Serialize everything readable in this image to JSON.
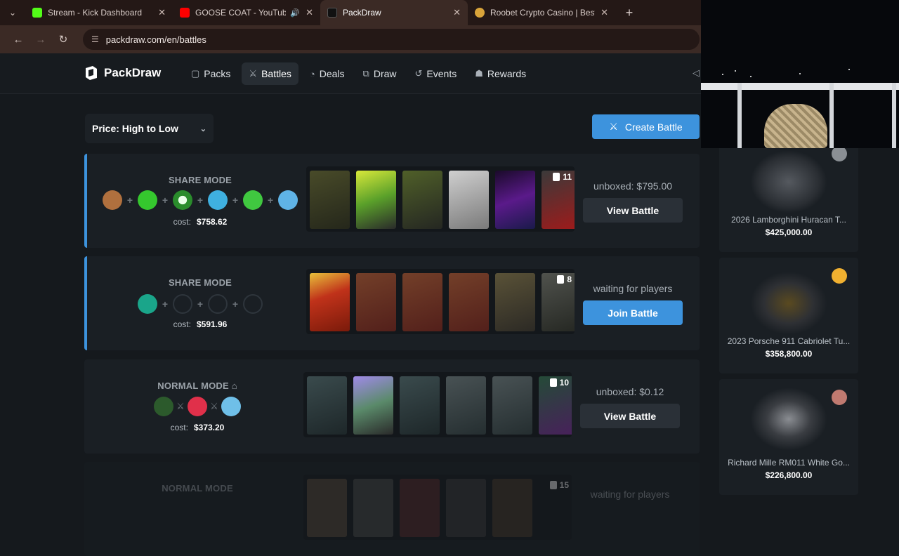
{
  "browser": {
    "tabs": [
      {
        "title": "Stream - Kick Dashboard",
        "fav_color": "#53fc18",
        "active": false
      },
      {
        "title": "GOOSE COAT - YouTube",
        "fav_color": "#ff0000",
        "active": false,
        "audio": true
      },
      {
        "title": "PackDraw",
        "fav_color": "#111111",
        "active": true
      },
      {
        "title": "Roobet Crypto Casino | Best Bit",
        "fav_color": "#d9a43a",
        "active": false
      }
    ],
    "new_tab": "+",
    "url": "packdraw.com/en/battles"
  },
  "header": {
    "logo": "PackDraw",
    "nav": [
      {
        "label": "Packs",
        "icon": "cube-icon"
      },
      {
        "label": "Battles",
        "icon": "swords-icon",
        "active": true
      },
      {
        "label": "Deals",
        "icon": "deals-icon"
      },
      {
        "label": "Draw",
        "icon": "draw-icon"
      },
      {
        "label": "Events",
        "icon": "events-icon"
      },
      {
        "label": "Rewards",
        "icon": "gift-icon"
      }
    ]
  },
  "controls": {
    "sort_label": "Price: High to Low",
    "create_label": "Create Battle"
  },
  "battles": [
    {
      "mode": "SHARE MODE",
      "cost_label": "cost:",
      "cost": "$758.62",
      "pack_count": "11",
      "status": "unboxed: $795.00",
      "action": "View Battle",
      "players": [
        "#b0703e",
        "#35c72e",
        "#2a8c2c",
        "#3fb0e0",
        "#40c840",
        "#5fb3e6"
      ],
      "packs": [
        "#6a6a2a",
        "#9ab82a",
        "#556c2a",
        "#8a8a8a",
        "#3a1a5a",
        "#8a1a1a"
      ]
    },
    {
      "mode": "SHARE MODE",
      "cost_label": "cost:",
      "cost": "$591.96",
      "pack_count": "8",
      "status": "waiting for players",
      "action": "Join Battle",
      "players": [
        "#1aa58a",
        "",
        "",
        ""
      ],
      "packs": [
        "#c0321a",
        "#7a2a1a",
        "#7a2a1a",
        "#7a2a1a",
        "#5a4a2a",
        "#4a4a3a"
      ]
    },
    {
      "mode": "NORMAL MODE",
      "cost_label": "cost:",
      "cost": "$373.20",
      "pack_count": "10",
      "status": "unboxed: $0.12",
      "action": "View Battle",
      "players": [
        "#2c5a2c",
        "#e0304a",
        "#6fbfe8"
      ],
      "packs": [
        "#3a5a5a",
        "#7a5ab0",
        "#3a5a5a",
        "#4a5a5a",
        "#4a5a5a",
        "#5a2a6a"
      ]
    },
    {
      "mode": "NORMAL MODE",
      "pack_count": "15",
      "status": "waiting for players"
    }
  ],
  "drops": [
    {
      "name": "2026 Lamborghini Huracan T...",
      "price": "$425,000.00",
      "img_color": "#3a3d42"
    },
    {
      "name": "2023 Porsche 911 Cabriolet Tu...",
      "price": "$358,800.00",
      "img_color": "#2e3034",
      "badge": "#f0b030"
    },
    {
      "name": "Richard Mille RM011 White Go...",
      "price": "$226,800.00",
      "img_color": "#707378",
      "badge": "#c07a70"
    }
  ]
}
